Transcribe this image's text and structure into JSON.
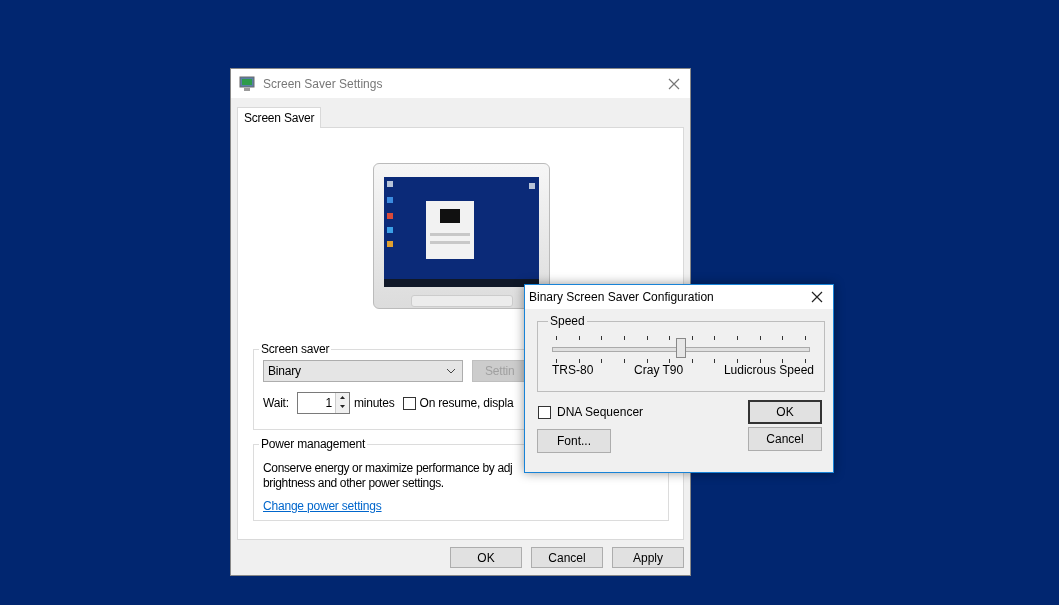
{
  "screen_saver_settings": {
    "title": "Screen Saver Settings",
    "tabs": [
      {
        "label": "Screen Saver",
        "selected": true
      }
    ],
    "screen_saver_group": {
      "label": "Screen saver",
      "selection": "Binary",
      "settings_button": {
        "label": "Settin",
        "disabled": true
      },
      "wait_label": "Wait:",
      "wait_value": "1",
      "minutes_label": "minutes",
      "on_resume": {
        "label": "On resume, displa",
        "checked": false
      }
    },
    "power_group": {
      "label": "Power management",
      "text_lines": [
        "Conserve energy or maximize performance by adj",
        "brightness and other power settings."
      ],
      "link": "Change power settings"
    },
    "buttons": [
      "OK",
      "Cancel",
      "Apply"
    ]
  },
  "configuration_dialog": {
    "title": "Binary Screen Saver Configuration",
    "speed": {
      "label": "Speed",
      "level": 0.5,
      "tick_labels": [
        "TRS-80",
        "Cray T90",
        "Ludicrous Speed"
      ]
    },
    "dna_sequencer": {
      "label": "DNA Sequencer",
      "checked": false
    },
    "font_button": "Font...",
    "buttons": [
      "OK",
      "Cancel"
    ]
  }
}
